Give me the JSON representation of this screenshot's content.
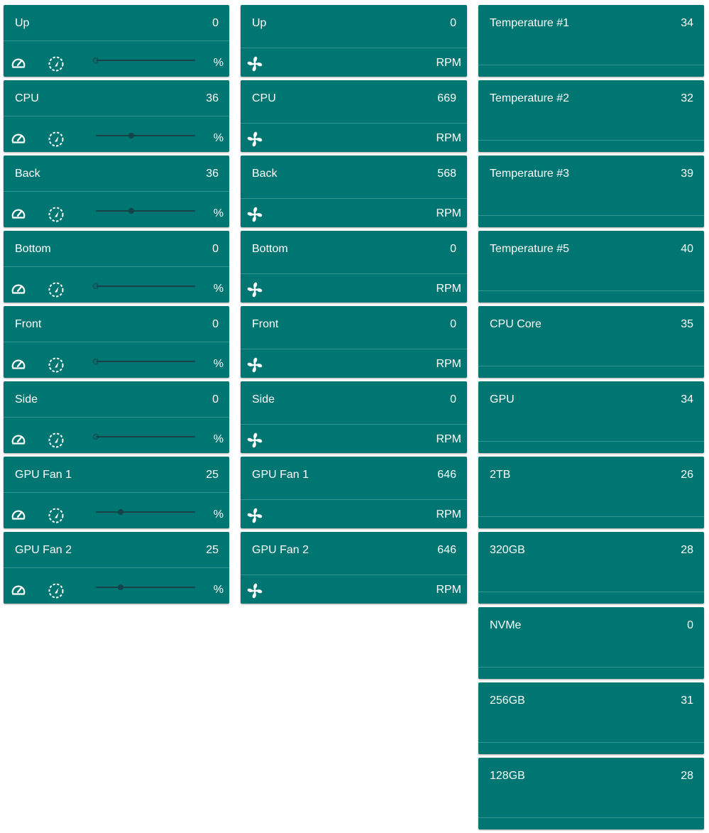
{
  "colors": {
    "card": "#007672",
    "text": "#ffffff",
    "slider": "#14434a"
  },
  "controls": [
    {
      "name": "Up",
      "value": "0",
      "unit": "%",
      "level": 0
    },
    {
      "name": "CPU",
      "value": "36",
      "unit": "%",
      "level": 36
    },
    {
      "name": "Back",
      "value": "36",
      "unit": "%",
      "level": 36
    },
    {
      "name": "Bottom",
      "value": "0",
      "unit": "%",
      "level": 0
    },
    {
      "name": "Front",
      "value": "0",
      "unit": "%",
      "level": 0
    },
    {
      "name": "Side",
      "value": "0",
      "unit": "%",
      "level": 0
    },
    {
      "name": "GPU Fan 1",
      "value": "25",
      "unit": "%",
      "level": 25
    },
    {
      "name": "GPU Fan 2",
      "value": "25",
      "unit": "%",
      "level": 25
    }
  ],
  "control_icons": {
    "left": "speedometer-icon",
    "right": "auto-mode-icon"
  },
  "fans": [
    {
      "name": "Up",
      "value": "0",
      "unit": "RPM"
    },
    {
      "name": "CPU",
      "value": "669",
      "unit": "RPM"
    },
    {
      "name": "Back",
      "value": "568",
      "unit": "RPM"
    },
    {
      "name": "Bottom",
      "value": "0",
      "unit": "RPM"
    },
    {
      "name": "Front",
      "value": "0",
      "unit": "RPM"
    },
    {
      "name": "Side",
      "value": "0",
      "unit": "RPM"
    },
    {
      "name": "GPU Fan 1",
      "value": "646",
      "unit": "RPM"
    },
    {
      "name": "GPU Fan 2",
      "value": "646",
      "unit": "RPM"
    }
  ],
  "fan_icon": "fan-icon",
  "temperatures": [
    {
      "name": "Temperature #1",
      "value": "34"
    },
    {
      "name": "Temperature #2",
      "value": "32"
    },
    {
      "name": "Temperature #3",
      "value": "39"
    },
    {
      "name": "Temperature #5",
      "value": "40"
    },
    {
      "name": "CPU Core",
      "value": "35"
    },
    {
      "name": "GPU",
      "value": "34"
    },
    {
      "name": "2TB",
      "value": "26"
    },
    {
      "name": "320GB",
      "value": "28"
    },
    {
      "name": "NVMe",
      "value": "0"
    },
    {
      "name": "256GB",
      "value": "31"
    },
    {
      "name": "128GB",
      "value": "28"
    }
  ]
}
